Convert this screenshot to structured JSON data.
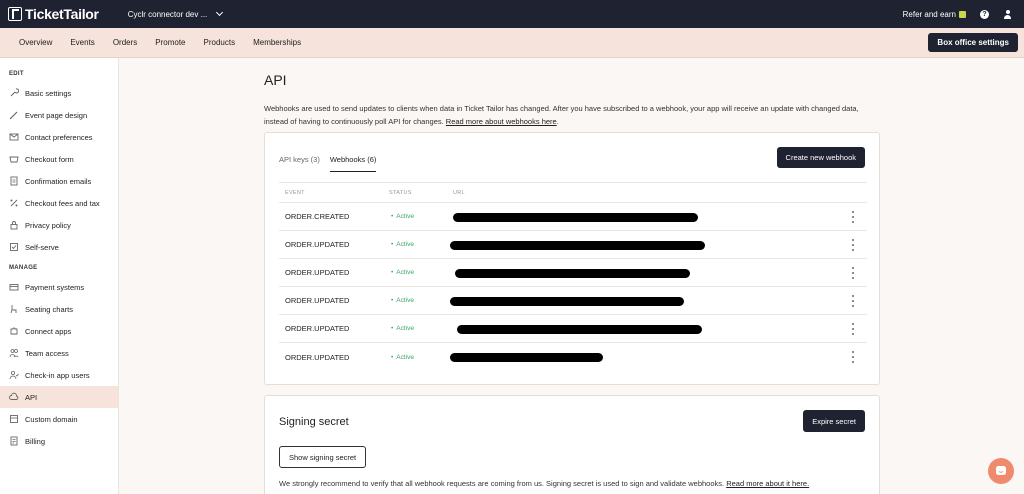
{
  "topbar": {
    "brand": "TicketTailor",
    "org_name": "Cyclr connector dev ...",
    "refer_label": "Refer and earn",
    "help_glyph": "?"
  },
  "nav": {
    "items": [
      "Overview",
      "Events",
      "Orders",
      "Promote",
      "Products",
      "Memberships"
    ],
    "box_office_label": "Box office settings"
  },
  "sidebar": {
    "edit_heading": "EDIT",
    "edit_items": [
      {
        "label": "Basic settings",
        "icon": "wrench-icon"
      },
      {
        "label": "Event page design",
        "icon": "brush-icon"
      },
      {
        "label": "Contact preferences",
        "icon": "mail-icon"
      },
      {
        "label": "Checkout form",
        "icon": "checkout-form-icon"
      },
      {
        "label": "Confirmation emails",
        "icon": "document-icon"
      },
      {
        "label": "Checkout fees and tax",
        "icon": "percent-icon"
      },
      {
        "label": "Privacy policy",
        "icon": "lock-icon"
      },
      {
        "label": "Self-serve",
        "icon": "self-serve-icon"
      }
    ],
    "manage_heading": "MANAGE",
    "manage_items": [
      {
        "label": "Payment systems",
        "icon": "credit-card-icon"
      },
      {
        "label": "Seating charts",
        "icon": "seat-icon"
      },
      {
        "label": "Connect apps",
        "icon": "puzzle-icon"
      },
      {
        "label": "Team access",
        "icon": "team-icon"
      },
      {
        "label": "Check-in app users",
        "icon": "user-check-icon"
      },
      {
        "label": "API",
        "icon": "cloud-icon",
        "active": true
      },
      {
        "label": "Custom domain",
        "icon": "globe-icon"
      },
      {
        "label": "Billing",
        "icon": "billing-icon"
      }
    ]
  },
  "page": {
    "title": "API",
    "intro_text": "Webhooks are used to send updates to clients when data in Ticket Tailor has changed. After you have subscribed to a webhook, your app will receive an update with changed data, instead of having to continuously poll API for changes.",
    "intro_link": "Read more about webhooks here"
  },
  "webhooks_card": {
    "tabs": [
      "API keys (3)",
      "Webhooks (6)"
    ],
    "active_tab": 1,
    "create_label": "Create new webhook",
    "columns": [
      "EVENT",
      "STATUS",
      "URL"
    ],
    "rows": [
      {
        "event": "ORDER.CREATED",
        "status": "Active"
      },
      {
        "event": "ORDER.UPDATED",
        "status": "Active"
      },
      {
        "event": "ORDER.UPDATED",
        "status": "Active"
      },
      {
        "event": "ORDER.UPDATED",
        "status": "Active"
      },
      {
        "event": "ORDER.UPDATED",
        "status": "Active"
      },
      {
        "event": "ORDER.UPDATED",
        "status": "Active"
      }
    ]
  },
  "signing_card": {
    "title": "Signing secret",
    "expire_label": "Expire secret",
    "show_label": "Show signing secret",
    "text": "We strongly recommend to verify that all webhook requests are coming from us. Signing secret is used to sign and validate webhooks.",
    "link": "Read more about it here."
  },
  "colors": {
    "dark": "#1f2230",
    "accent_bg": "#f5e3dc",
    "active_green": "#3aa56a",
    "chat": "#f08a6c"
  }
}
